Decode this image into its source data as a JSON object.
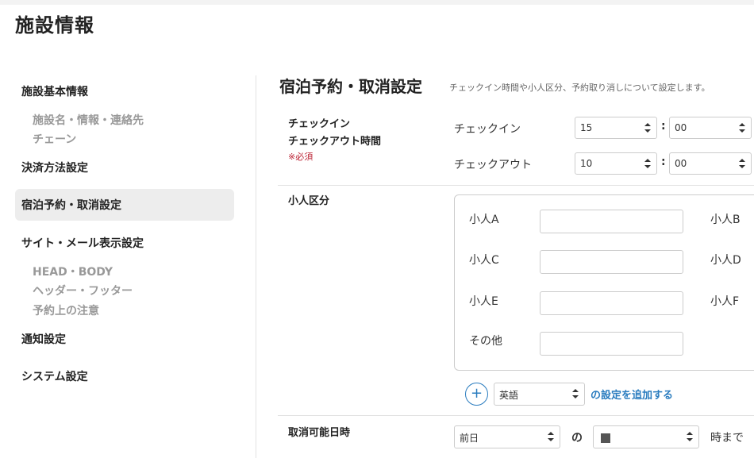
{
  "page": {
    "title": "施設情報"
  },
  "sidebar": {
    "items": [
      {
        "label": "施設基本情報",
        "sub": [
          "施設名・情報・連絡先",
          "チェーン"
        ]
      },
      {
        "label": "決済方法設定",
        "sub": []
      },
      {
        "label": "宿泊予約・取消設定",
        "sub": [],
        "active": true
      },
      {
        "label": "サイト・メール表示設定",
        "sub": [
          "HEAD・BODY",
          "ヘッダー・フッター",
          "予約上の注意"
        ]
      },
      {
        "label": "通知設定",
        "sub": []
      },
      {
        "label": "システム設定",
        "sub": []
      }
    ]
  },
  "main": {
    "title": "宿泊予約・取消設定",
    "description": "チェックイン時間や小人区分、予約取り消しについて設定します。",
    "checkin_row": {
      "label_line1": "チェックイン",
      "label_line2": "チェックアウト時間",
      "required": "※必須",
      "checkin_label": "チェックイン",
      "checkin_hour": "15",
      "checkin_min": "00",
      "checkout_label": "チェックアウト",
      "checkout_hour": "10",
      "checkout_min": "00",
      "colon": ":"
    },
    "child_row": {
      "label": "小人区分",
      "fields": [
        "小人A",
        "小人B",
        "小人C",
        "小人D",
        "小人E",
        "小人F",
        "その他"
      ],
      "add_language": "英語",
      "add_link": "の設定を追加する",
      "plus": "+"
    },
    "cancel_row": {
      "label": "取消可能日時",
      "day_select": "前日",
      "of": "の",
      "until": "時まで"
    }
  },
  "colors": {
    "accent": "#2a7cbf",
    "required": "#bb2233",
    "active_bg": "#ededed"
  }
}
